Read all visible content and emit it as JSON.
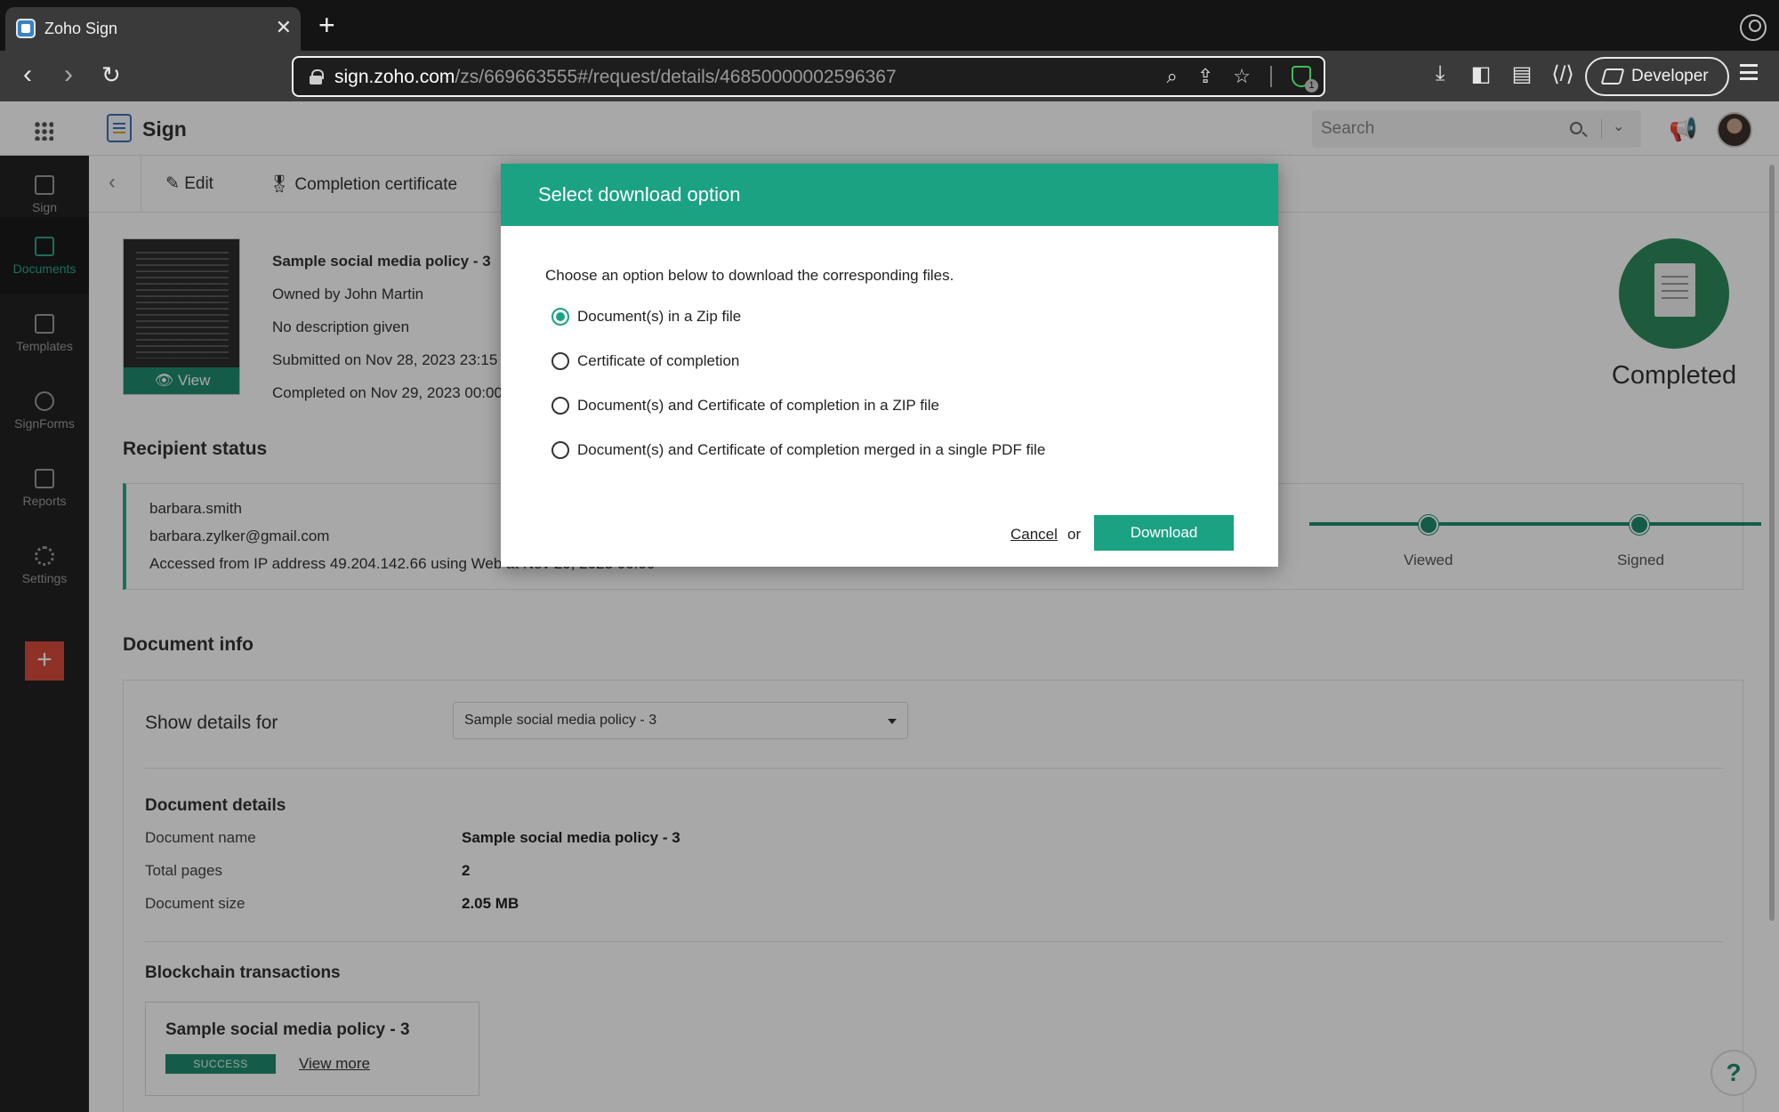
{
  "browser": {
    "tab_title": "Zoho Sign",
    "tab_close": "✕",
    "new_tab": "+",
    "url_host": "sign.zoho.com",
    "url_path": "/zs/669663555#/request/details/46850000002596367",
    "shield_badge": "1",
    "developer_label": "Developer"
  },
  "app": {
    "name": "Sign",
    "search_placeholder": "Search"
  },
  "sidebar": {
    "items": [
      {
        "label": "Sign",
        "icon": "home-icon"
      },
      {
        "label": "Documents",
        "icon": "documents-icon"
      },
      {
        "label": "Templates",
        "icon": "templates-icon"
      },
      {
        "label": "SignForms",
        "icon": "link-icon"
      },
      {
        "label": "Reports",
        "icon": "reports-icon"
      },
      {
        "label": "Settings",
        "icon": "gear-icon"
      }
    ],
    "add_label": "+"
  },
  "subbar": {
    "edit_label": "Edit",
    "certificate_label": "Completion certificate"
  },
  "document": {
    "thumb_view_label": "View",
    "title": "Sample social media policy - 3",
    "owner": "Owned by John Martin",
    "description": "No description given",
    "submitted": "Submitted on Nov 28, 2023 23:15",
    "completed": "Completed on Nov 29, 2023 00:00",
    "status": "Completed"
  },
  "recipient": {
    "section_title": "Recipient status",
    "name": "barbara.smith",
    "email": "barbara.zylker@gmail.com",
    "access": "Accessed from IP address 49.204.142.66 using Web at Nov 29, 2023 00:00",
    "timeline": [
      "Viewed",
      "Signed"
    ]
  },
  "doc_info": {
    "section_title": "Document info",
    "show_details_label": "Show details for",
    "selected_doc": "Sample social media policy - 3",
    "details_title": "Document details",
    "rows": [
      {
        "key": "Document name",
        "value": "Sample social media policy - 3"
      },
      {
        "key": "Total pages",
        "value": "2"
      },
      {
        "key": "Document size",
        "value": "2.05 MB"
      }
    ],
    "blockchain_title": "Blockchain transactions",
    "chain_doc": "Sample social media policy - 3",
    "chain_status": "SUCCESS",
    "chain_link": "View more"
  },
  "help_label": "?",
  "modal": {
    "title": "Select download option",
    "description": "Choose an option below to download the corresponding files.",
    "options": [
      {
        "label": "Document(s) in a Zip file",
        "selected": true
      },
      {
        "label": "Certificate of completion",
        "selected": false
      },
      {
        "label": "Document(s) and Certificate of completion in a ZIP file",
        "selected": false
      },
      {
        "label": "Document(s) and Certificate of completion merged in a single PDF file",
        "selected": false
      }
    ],
    "cancel_label": "Cancel",
    "or_label": "or",
    "download_label": "Download"
  },
  "colors": {
    "accent": "#1aa283",
    "success": "#1f8c70",
    "add_button": "#d94b3b"
  }
}
